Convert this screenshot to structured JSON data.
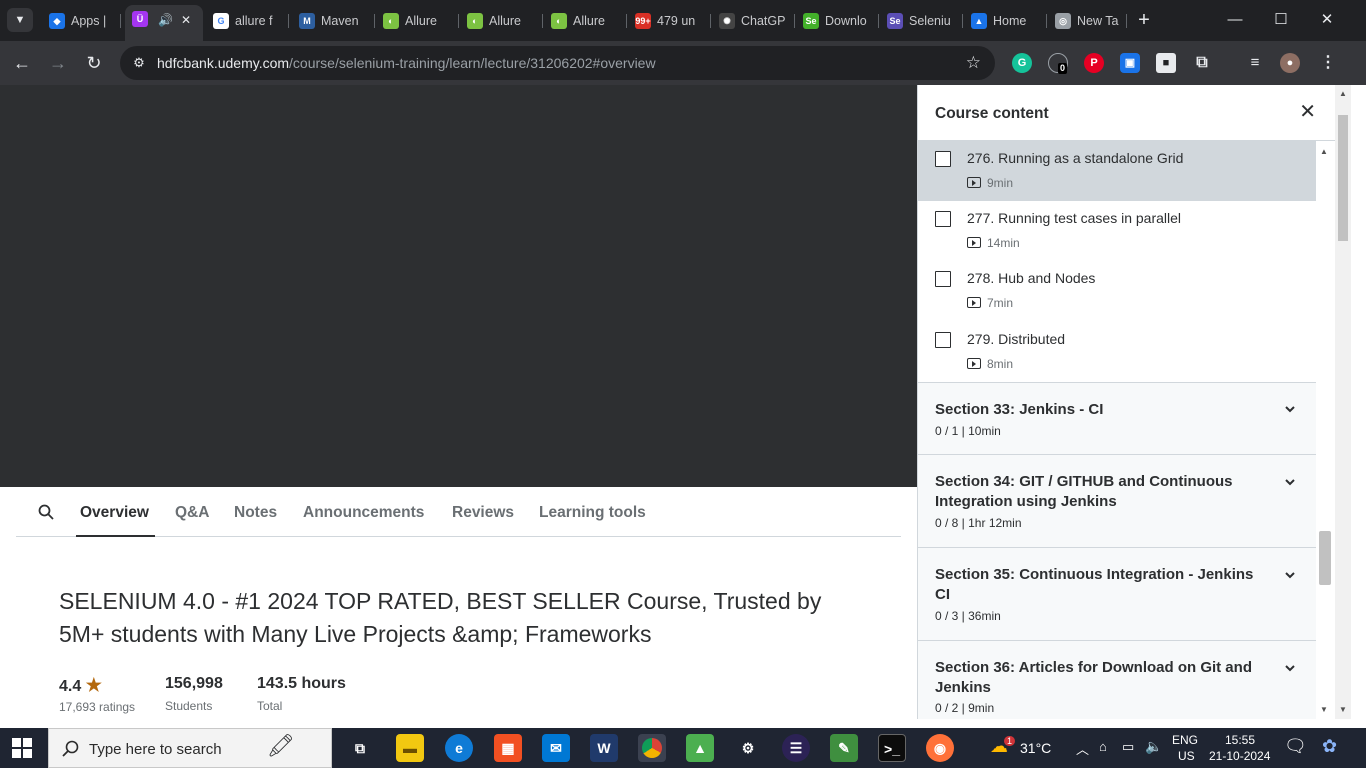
{
  "browser": {
    "tabs": [
      {
        "title": "Apps |",
        "fav": "◆",
        "color": "#1a73e8"
      },
      {
        "title": "",
        "fav": "Ü",
        "color": "#a435f0",
        "active": true
      },
      {
        "title": "allure f",
        "fav": "G",
        "color": "#ffffff"
      },
      {
        "title": "Maven",
        "fav": "M",
        "color": "#2d5fa0"
      },
      {
        "title": "Allure",
        "fav": "◐",
        "color": "#7cc242"
      },
      {
        "title": "Allure",
        "fav": "◐",
        "color": "#7cc242"
      },
      {
        "title": "Allure",
        "fav": "◐",
        "color": "#7cc242"
      },
      {
        "title": "479 un",
        "fav": "99+",
        "color": "#d93025"
      },
      {
        "title": "ChatGP",
        "fav": "✺",
        "color": "#444"
      },
      {
        "title": "Downlo",
        "fav": "Se",
        "color": "#43b02a"
      },
      {
        "title": "Seleniu",
        "fav": "Se",
        "color": "#5b4eb5"
      },
      {
        "title": "Home",
        "fav": "▲",
        "color": "#1a73e8"
      },
      {
        "title": "New Ta",
        "fav": "◎",
        "color": "#9aa0a6"
      }
    ],
    "url_host": "hdfcbank.udemy.com",
    "url_path": "/course/selenium-training/learn/lecture/31206202#overview",
    "ext_badge": "0"
  },
  "content_tabs": [
    "Overview",
    "Q&A",
    "Notes",
    "Announcements",
    "Reviews",
    "Learning tools"
  ],
  "course": {
    "title": "SELENIUM 4.0 - #1 2024 TOP RATED, BEST SELLER Course, Trusted by 5M+ students with Many Live Projects &amp; Frameworks",
    "rating": "4.4",
    "ratings_count": "17,693 ratings",
    "students": "156,998",
    "students_label": "Students",
    "hours": "143.5 hours",
    "hours_label": "Total"
  },
  "sidebar": {
    "title": "Course content",
    "lectures": [
      {
        "title": "276. Running as a standalone Grid",
        "duration": "9min",
        "current": true
      },
      {
        "title": "277. Running test cases in parallel",
        "duration": "14min"
      },
      {
        "title": "278. Hub and Nodes",
        "duration": "7min"
      },
      {
        "title": "279. Distributed",
        "duration": "8min"
      }
    ],
    "sections": [
      {
        "title": "Section 33: Jenkins - CI",
        "meta": "0 / 1 | 10min"
      },
      {
        "title": "Section 34: GIT / GITHUB and Continuous Integration using Jenkins",
        "meta": "0 / 8 | 1hr 12min"
      },
      {
        "title": "Section 35: Continuous Integration - Jenkins CI",
        "meta": "0 / 3 | 36min"
      },
      {
        "title": "Section 36: Articles for Download on Git and Jenkins",
        "meta": "0 / 2 | 9min"
      }
    ]
  },
  "taskbar": {
    "search_placeholder": "Type here to search",
    "weather": "31°C",
    "lang": "ENG",
    "region": "US",
    "time": "15:55",
    "date": "21-10-2024",
    "weather_badge": "1"
  }
}
